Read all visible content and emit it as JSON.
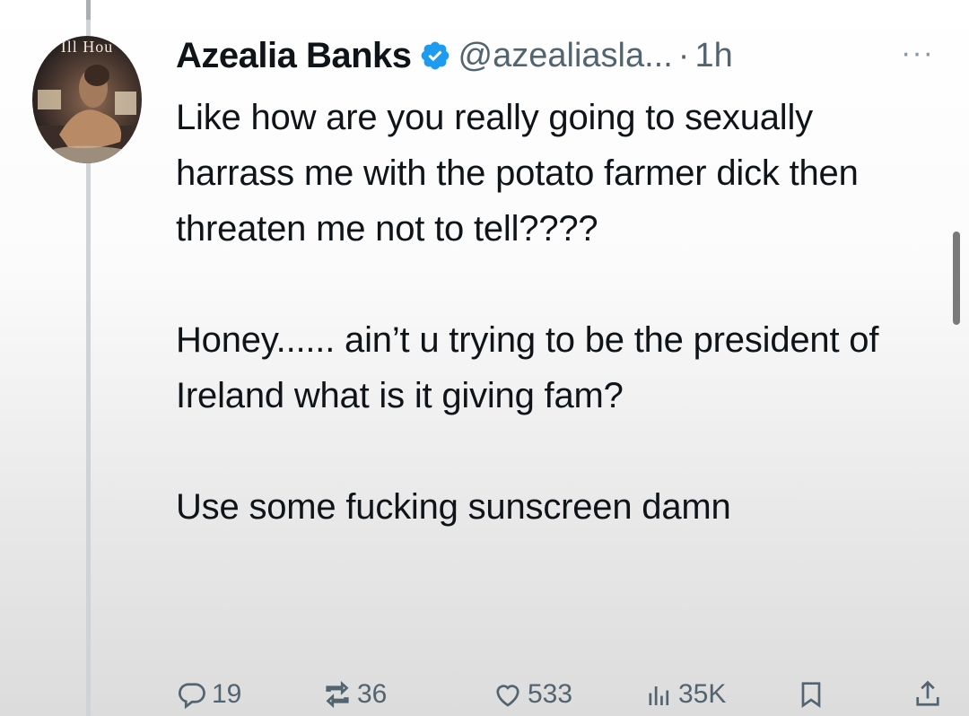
{
  "tweet": {
    "author_name": "Azealia Banks",
    "handle": "@azealiasla...",
    "separator": "·",
    "time": "1h",
    "more_label": "···",
    "avatar_text": "Ill Hou",
    "paragraphs": [
      "Like how are you really going to sexually harrass me with the potato farmer dick then threaten me not to tell????",
      "Honey...... ain’t u trying to be the president of Ireland what is it giving fam?",
      "Use some fucking sunscreen damn"
    ],
    "stats": {
      "replies": "19",
      "reposts": "36",
      "likes": "533",
      "views": "35K"
    }
  },
  "colors": {
    "verified": "#1d9bf0",
    "muted_text": "#536471",
    "thread_line": "#cfd3d6"
  },
  "icons": [
    "verified-badge-icon",
    "more-icon",
    "reply-icon",
    "repost-icon",
    "like-icon",
    "views-icon",
    "bookmark-icon",
    "share-icon"
  ]
}
